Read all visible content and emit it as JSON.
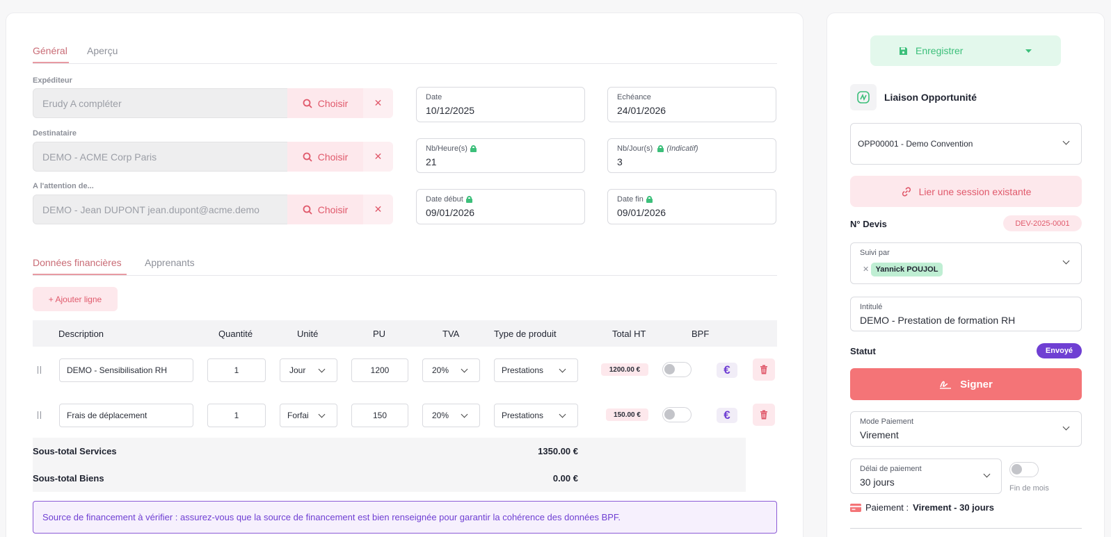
{
  "tabs_main": [
    {
      "label": "Général",
      "active": true
    },
    {
      "label": "Aperçu",
      "active": false
    }
  ],
  "sender": {
    "expediteur": {
      "label": "Expéditeur",
      "value": "Erudy A compléter"
    },
    "destinataire": {
      "label": "Destinataire",
      "value": "DEMO - ACME Corp Paris"
    },
    "attention": {
      "label": "A l'attention de...",
      "value": "DEMO - Jean DUPONT jean.dupont@acme.demo"
    },
    "choose_label": "Choisir",
    "clear_glyph": "✕"
  },
  "dates": {
    "date": {
      "label": "Date",
      "value": "10/12/2025"
    },
    "echeance": {
      "label": "Echéance",
      "value": "24/01/2026"
    },
    "nb_heures": {
      "label": "Nb/Heure(s)",
      "value": "21"
    },
    "nb_jours": {
      "label": "Nb/Jour(s)",
      "hint": "(Indicatif)",
      "value": "3"
    },
    "date_debut": {
      "label": "Date début",
      "value": "09/01/2026"
    },
    "date_fin": {
      "label": "Date fin",
      "value": "09/01/2026"
    }
  },
  "tabs_sub": [
    {
      "label": "Données financières",
      "active": true
    },
    {
      "label": "Apprenants",
      "active": false
    }
  ],
  "add_line_label": "+ Ajouter ligne",
  "table": {
    "headers": [
      "Description",
      "Quantité",
      "Unité",
      "PU",
      "TVA",
      "Type de produit",
      "Total HT",
      "BPF"
    ],
    "rows": [
      {
        "description": "DEMO - Sensibilisation RH",
        "quantite": "1",
        "unite": "Jour",
        "pu": "1200",
        "tva": "20%",
        "type": "Prestations",
        "total": "1200.00 €"
      },
      {
        "description": "Frais de déplacement",
        "quantite": "1",
        "unite": "Forfai",
        "pu": "150",
        "tva": "20%",
        "type": "Prestations",
        "total": "150.00 €"
      }
    ]
  },
  "subtotals": {
    "services": {
      "label": "Sous-total Services",
      "value": "1350.00 €"
    },
    "biens": {
      "label": "Sous-total Biens",
      "value": "0.00 €"
    }
  },
  "alert_text": "Source de financement à vérifier : assurez-vous que la source de financement est bien renseignée pour garantir la cohérence des données BPF.",
  "sidebar": {
    "save_label": "Enregistrer",
    "liaison_title": "Liaison Opportunité",
    "opportunity_value": "OPP00001 - Demo Convention",
    "link_session_label": "Lier une session existante",
    "devis_label": "N° Devis",
    "devis_value": "DEV-2025-0001",
    "suivi_label": "Suivi par",
    "suivi_chip": "Yannick POUJOL",
    "intitule_label": "Intitulé",
    "intitule_value": "DEMO - Prestation de formation RH",
    "statut_label": "Statut",
    "statut_value": "Envoyé",
    "sign_label": "Signer",
    "mode_paiement_label": "Mode Paiement",
    "mode_paiement_value": "Virement",
    "delai_label": "Délai de paiement",
    "delai_value": "30 jours",
    "fin_de_mois_label": "Fin de mois",
    "paiement_prefix": "Paiement :",
    "paiement_value": "Virement - 30 jours"
  },
  "colors": {
    "accent_pink": "#e0596b",
    "accent_green": "#3cbf7a",
    "accent_purple": "#6f3fd3",
    "sign_red": "#f47477"
  }
}
